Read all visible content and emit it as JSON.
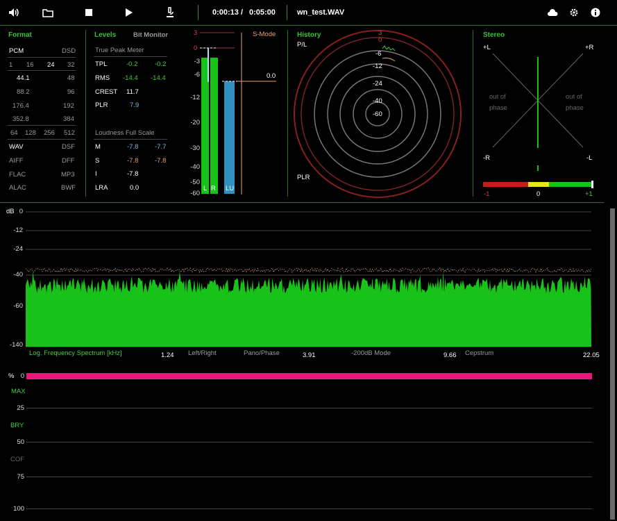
{
  "toolbar": {
    "icons": [
      "speaker-icon",
      "folder-icon",
      "stop-icon",
      "play-icon",
      "microscope-icon"
    ],
    "time_current": "0:00:13",
    "time_sep": "/",
    "time_total": "0:05:00",
    "filename": "wn_test.WAV",
    "right_icons": [
      "cloud-icon",
      "gear-icon",
      "info-icon"
    ]
  },
  "format": {
    "title": "Format",
    "pcm": "PCM",
    "dsd": "DSD",
    "bits": [
      "1",
      "16",
      "24",
      "32"
    ],
    "rates": [
      [
        "44.1",
        "48"
      ],
      [
        "88.2",
        "96"
      ],
      [
        "176.4",
        "192"
      ],
      [
        "352.8",
        "384"
      ]
    ],
    "dsd_rates": [
      "64",
      "128",
      "256",
      "512"
    ],
    "files": [
      [
        "WAV",
        "DSF"
      ],
      [
        "AIFF",
        "DFF"
      ],
      [
        "FLAC",
        "MP3"
      ],
      [
        "ALAC",
        "BWF"
      ]
    ]
  },
  "levels": {
    "title": "Levels",
    "bit_monitor": "Bit Monitor",
    "tpm_title": "True Peak Meter",
    "rows": [
      {
        "label": "TPL",
        "l": "-0.2",
        "r": "-0.2"
      },
      {
        "label": "RMS",
        "l": "-14.4",
        "r": "-14.4"
      },
      {
        "label": "CREST",
        "l": "11.7",
        "r": ""
      },
      {
        "label": "PLR",
        "l": "7.9",
        "r": ""
      }
    ],
    "lfs_title": "Loudness Full Scale",
    "lrows": [
      {
        "label": "M",
        "l": "-7.8",
        "r": "-7.7"
      },
      {
        "label": "S",
        "l": "-7.8",
        "r": "-7.8"
      },
      {
        "label": "I",
        "l": "-7.8",
        "r": ""
      },
      {
        "label": "LRA",
        "l": "0.0",
        "r": ""
      }
    ]
  },
  "meter": {
    "scale": [
      "3",
      "0",
      "-3",
      "-6",
      "-12",
      "-20",
      "-30",
      "-40",
      "-50",
      "-60"
    ],
    "l_label": "L",
    "r_label": "R",
    "lu_label": "LU",
    "s_mode": "S-Mode",
    "s_value": "0.0",
    "l_level": 0.93,
    "r_level": 0.93,
    "lu_level": 0.75
  },
  "history": {
    "title": "History",
    "pl": "P/L",
    "plr": "PLR",
    "rings": [
      "3",
      "0",
      "-6",
      "-12",
      "-24",
      "-40",
      "-60"
    ]
  },
  "stereo": {
    "title": "Stereo",
    "pl": "+L",
    "pr": "+R",
    "ml": "-R",
    "mr": "-L",
    "oop1": "out of",
    "oop2": "phase",
    "corr_min": "-1",
    "corr_mid": "0",
    "corr_max": "+1"
  },
  "spectrum": {
    "db_unit": "dB",
    "yticks": [
      "0",
      "-12",
      "-24",
      "-40",
      "-60",
      "-140"
    ],
    "bottom_label": "Log. Frequency Spectrum [kHz]",
    "freqs": [
      "1.24",
      "3.91",
      "9.66",
      "22.05"
    ],
    "modes": [
      "Left/Right",
      "Pano/Phase",
      "-200dB Mode",
      "Cepstrum"
    ],
    "colors": {
      "fill": "#19c219",
      "peak": "#e8b080"
    }
  },
  "bits": {
    "pct_unit": "%",
    "yticks": [
      "0",
      "25",
      "50",
      "75",
      "100"
    ],
    "labels": [
      "MAX",
      "BRY",
      "COF"
    ],
    "bar_color": "#e8197a"
  }
}
